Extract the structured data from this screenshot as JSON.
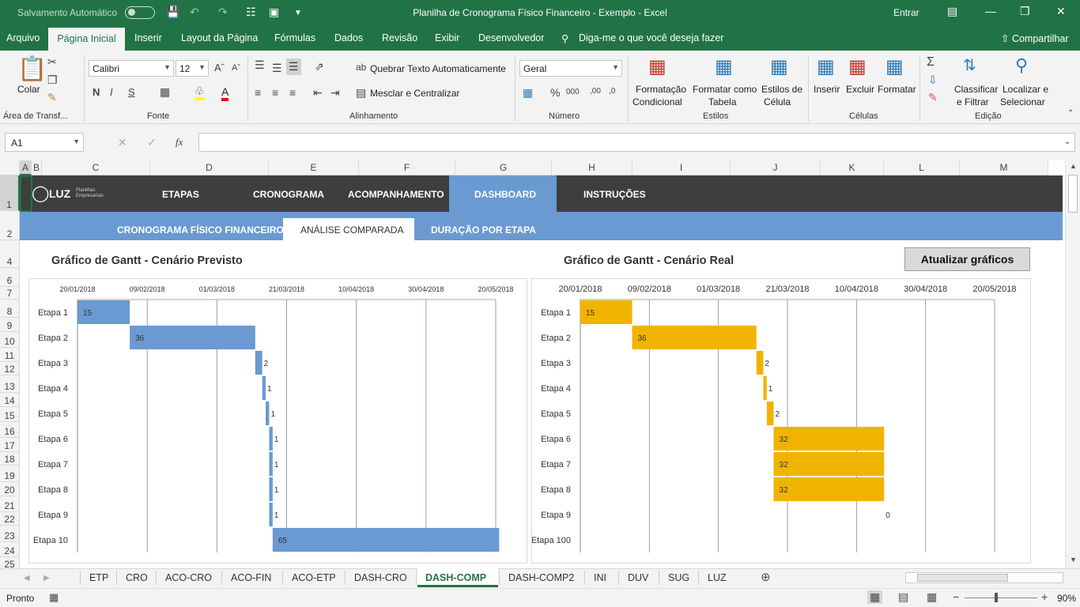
{
  "titlebar": {
    "autosave": "Salvamento Automático",
    "title": "Planilha de Cronograma Físico Financeiro - Exemplo  -  Excel",
    "entrar": "Entrar"
  },
  "menu": {
    "items": [
      "Arquivo",
      "Página Inicial",
      "Inserir",
      "Layout da Página",
      "Fórmulas",
      "Dados",
      "Revisão",
      "Exibir",
      "Desenvolvedor"
    ],
    "active": "Página Inicial",
    "tell": "Diga-me o que você deseja fazer",
    "share": "Compartilhar"
  },
  "ribbon": {
    "colar": "Colar",
    "area_label": "Área de Transf...",
    "font_name": "Calibri",
    "font_size": "12",
    "fonte_label": "Fonte",
    "wrap": "Quebrar Texto Automaticamente",
    "merge": "Mesclar e Centralizar",
    "align_label": "Alinhamento",
    "number_format": "Geral",
    "numero_label": "Número",
    "cond1": "Formatação",
    "cond2": "Condicional",
    "fmt1": "Formatar como",
    "fmt2": "Tabela",
    "sty1": "Estilos de",
    "sty2": "Célula",
    "estilos_label": "Estilos",
    "insert": "Inserir",
    "delete": "Excluir",
    "format": "Formatar",
    "celulas_label": "Células",
    "sort1": "Classificar",
    "sort2": "e Filtrar",
    "find1": "Localizar e",
    "find2": "Selecionar",
    "edicao_label": "Edição"
  },
  "formula_bar": {
    "name_box": "A1",
    "fx": "fx"
  },
  "columns": [
    "A",
    "B",
    "C",
    "D",
    "E",
    "F",
    "G",
    "H",
    "I",
    "J",
    "K",
    "L",
    "M"
  ],
  "rows": [
    "1",
    "2",
    "4",
    "6",
    "7",
    "8",
    "9",
    "10",
    "11",
    "12",
    "13",
    "14",
    "15",
    "16",
    "17",
    "18",
    "19",
    "20",
    "21",
    "22",
    "23",
    "24",
    "25"
  ],
  "nav": {
    "items": [
      "ETAPAS",
      "CRONOGRAMA",
      "ACOMPANHAMENTO",
      "DASHBOARD",
      "INSTRUÇÕES"
    ],
    "active": "DASHBOARD",
    "logo": "LUZ",
    "logo_sub1": "Planilhas",
    "logo_sub2": "Empresariais"
  },
  "subnav": {
    "items": [
      "CRONOGRAMA FÍSICO FINANCEIRO",
      "ANÁLISE COMPARADA",
      "DURAÇÃO POR ETAPA"
    ],
    "active": "ANÁLISE COMPARADA"
  },
  "update_button": "Atualizar gráficos",
  "chart_data": [
    {
      "type": "bar",
      "orientation": "gantt",
      "title": "Gráfico de Gantt - Cenário Previsto",
      "x_ticks": [
        "20/01/2018",
        "09/02/2018",
        "01/03/2018",
        "21/03/2018",
        "10/04/2018",
        "30/04/2018",
        "20/05/2018"
      ],
      "categories": [
        "Etapa 1",
        "Etapa 2",
        "Etapa 3",
        "Etapa 4",
        "Etapa 5",
        "Etapa 6",
        "Etapa 7",
        "Etapa 8",
        "Etapa 9",
        "Etapa 10"
      ],
      "start_days": [
        0,
        15,
        51,
        53,
        54,
        55,
        55,
        55,
        55,
        56
      ],
      "values": [
        15,
        36,
        2,
        1,
        1,
        1,
        1,
        1,
        1,
        65
      ],
      "x_range_days": [
        0,
        120
      ],
      "color": "#6a9ad1",
      "grid": true
    },
    {
      "type": "bar",
      "orientation": "gantt",
      "title": "Gráfico de Gantt - Cenário Real",
      "x_ticks": [
        "20/01/2018",
        "09/02/2018",
        "01/03/2018",
        "21/03/2018",
        "10/04/2018",
        "30/04/2018",
        "20/05/2018"
      ],
      "categories": [
        "Etapa 1",
        "Etapa 2",
        "Etapa 3",
        "Etapa 4",
        "Etapa 5",
        "Etapa 6",
        "Etapa 7",
        "Etapa 8",
        "Etapa 9",
        "Etapa 100"
      ],
      "start_days": [
        0,
        15,
        51,
        53,
        54,
        56,
        56,
        56,
        88,
        null
      ],
      "values": [
        15,
        36,
        2,
        1,
        2,
        32,
        32,
        32,
        0,
        null
      ],
      "x_range_days": [
        0,
        120
      ],
      "color": "#f0b400",
      "grid": true
    }
  ],
  "sheet_tabs": [
    "ETP",
    "CRO",
    "ACO-CRO",
    "ACO-FIN",
    "ACO-ETP",
    "DASH-CRO",
    "DASH-COMP",
    "DASH-COMP2",
    "INI",
    "DUV",
    "SUG",
    "LUZ"
  ],
  "active_tab": "DASH-COMP",
  "status": {
    "ready": "Pronto",
    "zoom": "90%"
  }
}
